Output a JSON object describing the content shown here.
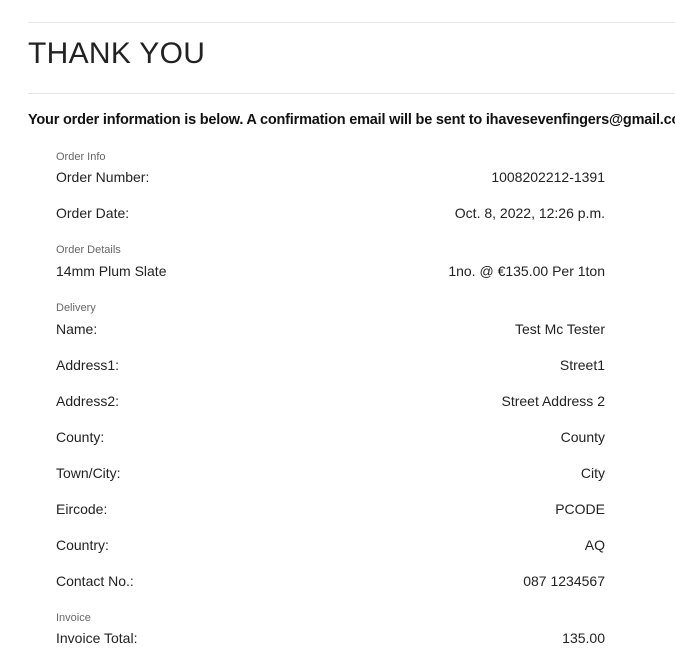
{
  "title": "THANK YOU",
  "intro": "Your order information is below. A confirmation email will be sent to ihavesevenfingers@gmail.com.",
  "order_info": {
    "label": "Order Info",
    "order_number_label": "Order Number:",
    "order_number": "1008202212-1391",
    "order_date_label": "Order Date:",
    "order_date": "Oct. 8, 2022, 12:26 p.m."
  },
  "order_details": {
    "label": "Order Details",
    "items": [
      {
        "name": "14mm Plum Slate",
        "qty_price": "1no. @ €135.00 Per 1ton"
      }
    ]
  },
  "delivery": {
    "label": "Delivery",
    "fields": [
      {
        "label": "Name:",
        "value": "Test Mc Tester"
      },
      {
        "label": "Address1:",
        "value": "Street1"
      },
      {
        "label": "Address2:",
        "value": "Street Address 2"
      },
      {
        "label": "County:",
        "value": "County"
      },
      {
        "label": "Town/City:",
        "value": "City"
      },
      {
        "label": "Eircode:",
        "value": "PCODE"
      },
      {
        "label": "Country:",
        "value": "AQ"
      },
      {
        "label": "Contact No.:",
        "value": "087 1234567"
      }
    ]
  },
  "invoice": {
    "label": "Invoice",
    "total_label": "Invoice Total:",
    "total": "135.00"
  }
}
